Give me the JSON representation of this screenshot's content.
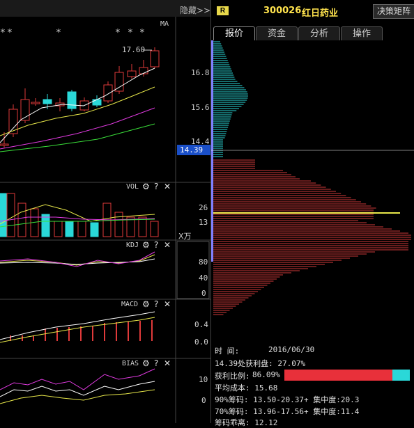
{
  "header": {
    "hide_label": "隐藏>>",
    "badge": "R",
    "stock_code": "300026",
    "stock_name": "红日药业",
    "decision_button": "决策矩阵"
  },
  "tabs": [
    "报价",
    "资金",
    "分析",
    "操作"
  ],
  "main_chart": {
    "indicator": "MA",
    "high_marker": "17.60",
    "price_ticks": [
      "16.8",
      "15.6",
      "14.4"
    ],
    "current_price": "14.39",
    "star": "*"
  },
  "vol_panel": {
    "name": "VOL",
    "ticks": [
      "26",
      "13"
    ],
    "unit": "X万"
  },
  "kdj_panel": {
    "name": "KDJ",
    "ticks": [
      "80",
      "40",
      "0"
    ]
  },
  "macd_panel": {
    "name": "MACD",
    "ticks": [
      "0.4",
      "0.0"
    ]
  },
  "bias_panel": {
    "name": "BIAS",
    "ticks": [
      "10",
      "0"
    ]
  },
  "panel_icons": {
    "gear": "⚙",
    "help": "?",
    "close": "✕"
  },
  "chip_info": {
    "time_label": "时        间:",
    "time_value": "2016/06/30",
    "profit_text": "14.39处获利盘: 27.07%",
    "profit_ratio_label": "获利比例:",
    "profit_ratio_value": "86.09%",
    "profit_ratio": 0.86,
    "avg_cost": "平均成本: 15.68",
    "chip90": "90%筹码: 13.50-20.37+ 集中度:20.3",
    "chip70": "70%筹码: 13.96-17.56+ 集中度:11.4",
    "spread": "筹码乖离: 12.12"
  },
  "colors": {
    "red": "#e03a3a",
    "cyan": "#2ad8d8",
    "blue_price": "#1a4fc8"
  }
}
